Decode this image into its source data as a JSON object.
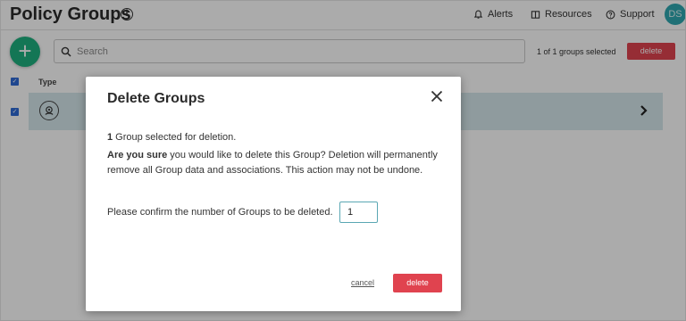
{
  "header": {
    "title": "Policy Groups",
    "info_icon": "info-icon",
    "nav": [
      {
        "label": "Alerts",
        "icon": "bell-icon"
      },
      {
        "label": "Resources",
        "icon": "resources-icon"
      },
      {
        "label": "Support",
        "icon": "help-circle-icon"
      }
    ],
    "avatar_initials": "DS"
  },
  "toolbar": {
    "add_label": "+",
    "search_placeholder": "Search",
    "selected_count": "1 of 1 groups selected",
    "delete_label": "delete"
  },
  "table": {
    "column_type": "Type"
  },
  "modal": {
    "title": "Delete Groups",
    "count": "1",
    "selected_text": " Group selected for deletion.",
    "warning_bold": "Are you sure",
    "warning_text": " you would like to delete this Group? Deletion will permanently remove all Group data and associations. This action may not be undone.",
    "confirm_label": "Please confirm the number of Groups to be deleted.",
    "confirm_value": "1",
    "cancel_label": "cancel",
    "delete_label": "delete"
  },
  "colors": {
    "accent_green": "#1fb07f",
    "danger_red": "#e0434f",
    "row_highlight": "#d6e8ec",
    "avatar_teal": "#2fa8b0",
    "checkbox_blue": "#2f6bd6"
  }
}
